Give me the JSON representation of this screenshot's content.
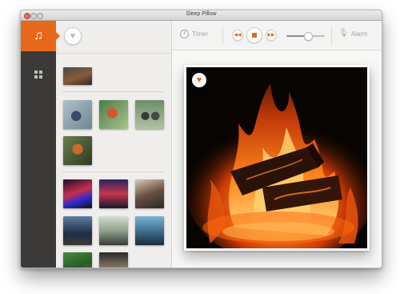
{
  "window": {
    "title": "Sleep Pillow"
  },
  "sidebar": {
    "items": [
      {
        "name": "music",
        "icon": "music-note-icon",
        "selected": true
      },
      {
        "name": "grid",
        "icon": "grid-icon",
        "selected": false
      }
    ]
  },
  "toolbar": {
    "timer_label": "Timer",
    "alarm_label": "Alarm",
    "volume_level": 0.55
  },
  "thumbnails": {
    "favorites_icon": "heart-icon",
    "sections": [
      {
        "count": 1
      },
      {
        "count": 4
      },
      {
        "count": 8
      }
    ]
  },
  "player": {
    "favorite_icon": "heart-icon",
    "favorited": true
  },
  "colors": {
    "accent": "#e8681b",
    "rail": "#3c3a38"
  }
}
